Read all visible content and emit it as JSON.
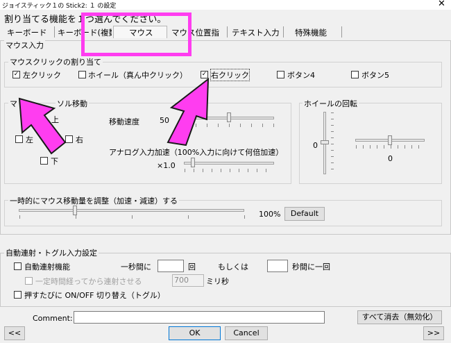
{
  "window": {
    "title": "ジョイスティック１の Stick2: １ の設定",
    "close_glyph": "✕"
  },
  "subtitle": "割り当てる機能を１つ選んでください。",
  "tabs": [
    {
      "label": "キーボード"
    },
    {
      "label": "キーボード(複数"
    },
    {
      "label": "マウス"
    },
    {
      "label": "マウス位置指"
    },
    {
      "label": "テキスト入力"
    },
    {
      "label": "特殊機能"
    }
  ],
  "mouse": {
    "section": "マウス入力",
    "click_group": "マウスクリックの割り当て",
    "clicks": [
      {
        "label": "左クリック",
        "checked": true
      },
      {
        "label": "ホイール（真ん中クリック）",
        "checked": false
      },
      {
        "label": "右クリック",
        "checked": true
      },
      {
        "label": "ボタン4",
        "checked": false
      },
      {
        "label": "ボタン5",
        "checked": false
      }
    ],
    "cursor_group": "マウスカーソル移動",
    "cursor_group_visible": "マ",
    "cursor_group_tail": "ソル移動",
    "dirs": {
      "up": "上",
      "left": "左",
      "right": "右",
      "down": "下"
    },
    "speed_label": "移動速度",
    "speed_value": "50",
    "analog_label": "アナログ入力加速（100%入力に向けて何倍加速）",
    "analog_value": "×1.0",
    "wheel_group": "ホイールの回転",
    "wheel_v_value": "0",
    "wheel_h_value": "0",
    "adjust_group": "一時的にマウス移動量を調整（加速・減速）する",
    "adjust_value": "100%",
    "default_button": "Default"
  },
  "auto": {
    "section": "自動連射・トグル入力設定",
    "rapid_label": "自動連射機能",
    "per_second_label": "一秒間に",
    "count_unit": "回",
    "or_label": "もしくは",
    "seconds_unit": "秒間に一回",
    "delay_label": "一定時間経ってから連射させる",
    "delay_value": "700",
    "ms_unit": "ミリ秒",
    "toggle_label": "押すたびに ON/OFF 切り替え（トグル）"
  },
  "footer": {
    "comment_label": "Comment:",
    "comment_value": "",
    "clear_all": "すべて消去（無効化）",
    "prev": "<<",
    "ok": "OK",
    "cancel": "Cancel",
    "next": ">>"
  },
  "annotation_color": "#ff3df0",
  "speed_level": 0.5,
  "analog_level": 0.1,
  "adjust_level": 0.25
}
